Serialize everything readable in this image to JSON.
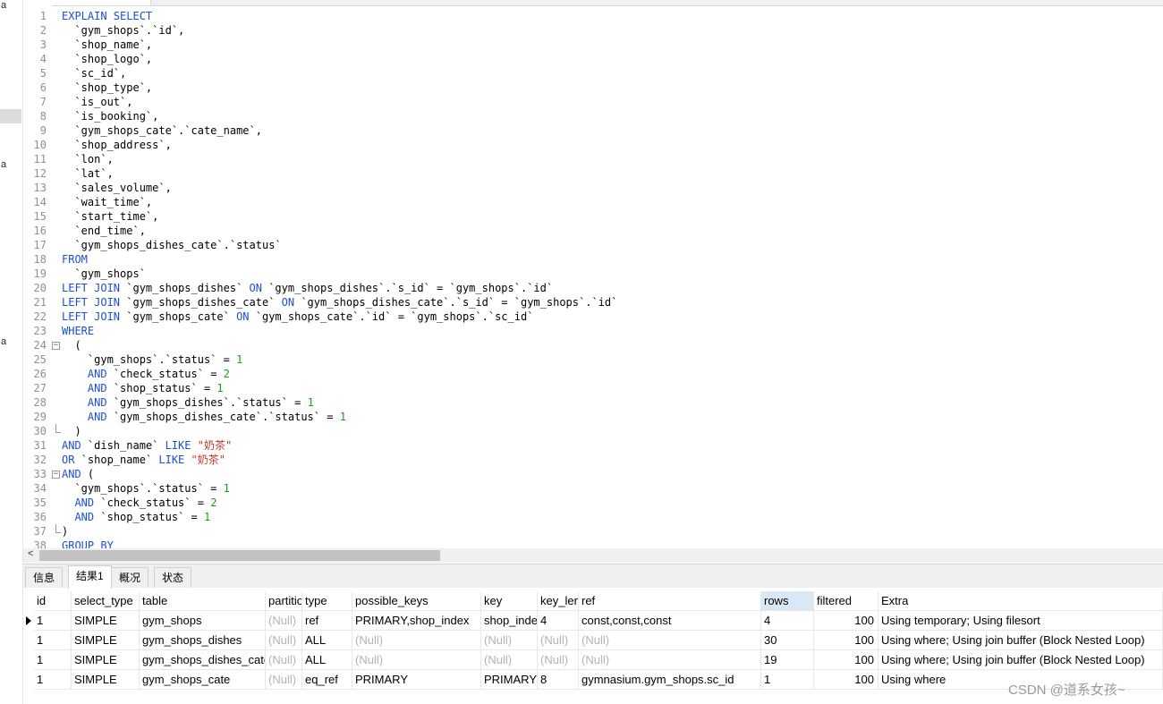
{
  "editor": {
    "lines": [
      [
        [
          "EXPLAIN SELECT",
          "kw"
        ]
      ],
      [
        [
          "  `gym_shops`.`id`,",
          ""
        ]
      ],
      [
        [
          "  `shop_name`,",
          ""
        ]
      ],
      [
        [
          "  `shop_logo`,",
          ""
        ]
      ],
      [
        [
          "  `sc_id`,",
          ""
        ]
      ],
      [
        [
          "  `shop_type`,",
          ""
        ]
      ],
      [
        [
          "  `is_out`,",
          ""
        ]
      ],
      [
        [
          "  `is_booking`,",
          ""
        ]
      ],
      [
        [
          "  `gym_shops_cate`.`cate_name`,",
          ""
        ]
      ],
      [
        [
          "  `shop_address`,",
          ""
        ]
      ],
      [
        [
          "  `lon`,",
          ""
        ]
      ],
      [
        [
          "  `lat`,",
          ""
        ]
      ],
      [
        [
          "  `sales_volume`,",
          ""
        ]
      ],
      [
        [
          "  `wait_time`,",
          ""
        ]
      ],
      [
        [
          "  `start_time`,",
          ""
        ]
      ],
      [
        [
          "  `end_time`,",
          ""
        ]
      ],
      [
        [
          "  `gym_shops_dishes_cate`.`status`",
          ""
        ]
      ],
      [
        [
          "FROM",
          "kw"
        ]
      ],
      [
        [
          "  `gym_shops`",
          ""
        ]
      ],
      [
        [
          "LEFT JOIN",
          "kw"
        ],
        [
          " `gym_shops_dishes` ",
          ""
        ],
        [
          "ON",
          "kw"
        ],
        [
          " `gym_shops_dishes`.`s_id` = `gym_shops`.`id`",
          ""
        ]
      ],
      [
        [
          "LEFT JOIN",
          "kw"
        ],
        [
          " `gym_shops_dishes_cate` ",
          ""
        ],
        [
          "ON",
          "kw"
        ],
        [
          " `gym_shops_dishes_cate`.`s_id` = `gym_shops`.`id`",
          ""
        ]
      ],
      [
        [
          "LEFT JOIN",
          "kw"
        ],
        [
          " `gym_shops_cate` ",
          ""
        ],
        [
          "ON",
          "kw"
        ],
        [
          " `gym_shops_cate`.`id` = `gym_shops`.`sc_id`",
          ""
        ]
      ],
      [
        [
          "WHERE",
          "kw"
        ]
      ],
      [
        [
          "  (",
          ""
        ]
      ],
      [
        [
          "    `gym_shops`.`status` = ",
          ""
        ],
        [
          "1",
          "num"
        ]
      ],
      [
        [
          "    ",
          ""
        ],
        [
          "AND",
          "kw"
        ],
        [
          " `check_status` = ",
          ""
        ],
        [
          "2",
          "num"
        ]
      ],
      [
        [
          "    ",
          ""
        ],
        [
          "AND",
          "kw"
        ],
        [
          " `shop_status` = ",
          ""
        ],
        [
          "1",
          "num"
        ]
      ],
      [
        [
          "    ",
          ""
        ],
        [
          "AND",
          "kw"
        ],
        [
          " `gym_shops_dishes`.`status` = ",
          ""
        ],
        [
          "1",
          "num"
        ]
      ],
      [
        [
          "    ",
          ""
        ],
        [
          "AND",
          "kw"
        ],
        [
          " `gym_shops_dishes_cate`.`status` = ",
          ""
        ],
        [
          "1",
          "num"
        ]
      ],
      [
        [
          "  )",
          ""
        ]
      ],
      [
        [
          "AND",
          "kw"
        ],
        [
          " `dish_name` ",
          ""
        ],
        [
          "LIKE",
          "kw"
        ],
        [
          " ",
          ""
        ],
        [
          "\"奶茶\"",
          "str"
        ]
      ],
      [
        [
          "OR",
          "kw"
        ],
        [
          " `shop_name` ",
          ""
        ],
        [
          "LIKE",
          "kw"
        ],
        [
          " ",
          ""
        ],
        [
          "\"奶茶\"",
          "str"
        ]
      ],
      [
        [
          "AND",
          "kw"
        ],
        [
          " (",
          ""
        ]
      ],
      [
        [
          "  `gym_shops`.`status` = ",
          ""
        ],
        [
          "1",
          "num"
        ]
      ],
      [
        [
          "  ",
          ""
        ],
        [
          "AND",
          "kw"
        ],
        [
          " `check_status` = ",
          ""
        ],
        [
          "2",
          "num"
        ]
      ],
      [
        [
          "  ",
          ""
        ],
        [
          "AND",
          "kw"
        ],
        [
          " `shop_status` = ",
          ""
        ],
        [
          "1",
          "num"
        ]
      ],
      [
        [
          ")",
          ""
        ]
      ],
      [
        [
          "GROUP BY",
          "kw"
        ]
      ]
    ],
    "fold_open": [
      24,
      33
    ],
    "fold_close": [
      30,
      37
    ]
  },
  "left_marks": [
    "a",
    "a",
    "a"
  ],
  "tabs": [
    "信息",
    "结果1",
    "概况",
    "状态"
  ],
  "active_tab": 1,
  "result": {
    "columns": [
      "id",
      "select_type",
      "table",
      "partitions",
      "type",
      "possible_keys",
      "key",
      "key_len",
      "ref",
      "rows",
      "filtered",
      "Extra"
    ],
    "rows": [
      [
        "1",
        "SIMPLE",
        "gym_shops",
        "(Null)",
        "ref",
        "PRIMARY,shop_index",
        "shop_index",
        "4",
        "const,const,const",
        "4",
        "100",
        "Using temporary; Using filesort"
      ],
      [
        "1",
        "SIMPLE",
        "gym_shops_dishes",
        "(Null)",
        "ALL",
        "(Null)",
        "(Null)",
        "(Null)",
        "(Null)",
        "30",
        "100",
        "Using where; Using join buffer (Block Nested Loop)"
      ],
      [
        "1",
        "SIMPLE",
        "gym_shops_dishes_cate",
        "(Null)",
        "ALL",
        "(Null)",
        "(Null)",
        "(Null)",
        "(Null)",
        "19",
        "100",
        "Using where; Using join buffer (Block Nested Loop)"
      ],
      [
        "1",
        "SIMPLE",
        "gym_shops_cate",
        "(Null)",
        "eq_ref",
        "PRIMARY",
        "PRIMARY",
        "8",
        "gymnasium.gym_shops.sc_id",
        "1",
        "100",
        "Using where"
      ]
    ]
  },
  "watermark": "CSDN @道系女孩~",
  "colors": {
    "keyword": "#1a4fd6",
    "number": "#1c9a1c",
    "string": "#c0392b",
    "null": "#b3b3b3"
  }
}
